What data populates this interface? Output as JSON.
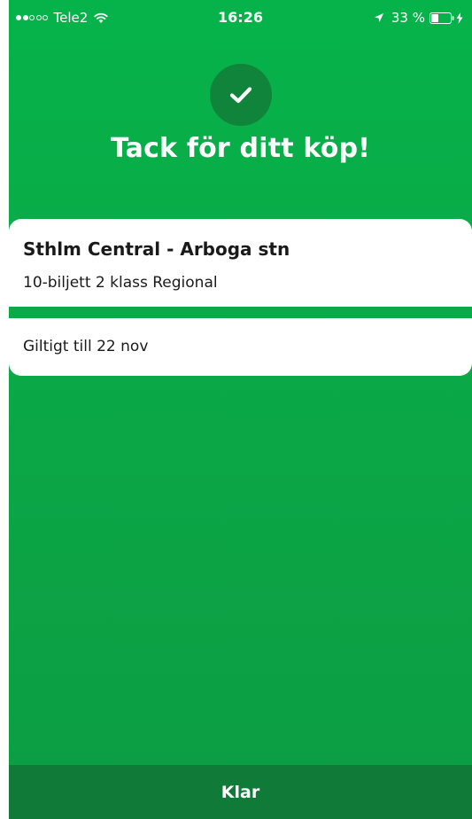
{
  "status_bar": {
    "carrier": "Tele2",
    "time": "16:26",
    "battery_percent": "33 %",
    "signal_strength": 2,
    "signal_max": 5
  },
  "confirmation": {
    "title": "Tack för ditt köp!",
    "icon": "checkmark-icon"
  },
  "ticket": {
    "route": "Sthlm Central - Arboga stn",
    "type": "10-biljett 2 klass Regional",
    "valid_until": "Giltigt till 22 nov"
  },
  "actions": {
    "done_label": "Klar"
  },
  "colors": {
    "background": "#0aa947",
    "check_circle": "#10843a",
    "button": "#107b38",
    "card": "#ffffff"
  }
}
